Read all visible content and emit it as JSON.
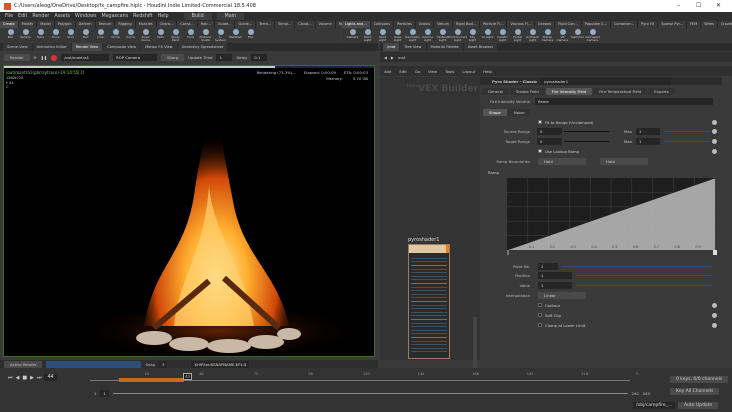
{
  "window": {
    "title": "C:/Users/aleog/OneDrive/Desktop/fx_campfire.hiplc - Houdini Indie Limited-Commercial 18.5.408",
    "min": "–",
    "max": "☐",
    "close": "✕"
  },
  "menu": {
    "items": [
      "File",
      "Edit",
      "Render",
      "Assets",
      "Windows",
      "Megascans",
      "Redshift",
      "Help"
    ],
    "desktop": "Build",
    "desktop2": "Main"
  },
  "shelf_tabs_left": [
    "Create",
    "Modify",
    "Model",
    "Polygon",
    "Deform",
    "Texture",
    "Rigging",
    "Muscles",
    "Chara...",
    "Const...",
    "Hair...",
    "Guide...",
    "Guide...",
    "Terra...",
    "Simpl...",
    "Cloud...",
    "Volume",
    "Redshift"
  ],
  "shelf_tabs_right": [
    "Lights and...",
    "Collisions",
    "Particles",
    "Grains",
    "Vellum",
    "Rigid Bod...",
    "Particle Fl...",
    "Viscous Fl...",
    "Oceans",
    "Fluid Con...",
    "Populate C...",
    "Container...",
    "Pyro FX",
    "Sparse Pyr...",
    "FEM",
    "Wires",
    "Crowds",
    "Drive Sim..."
  ],
  "tools_left": [
    "Box",
    "Sphere",
    "Tube",
    "Torus",
    "Grid",
    "Null",
    "Line",
    "Circle",
    "Curve",
    "Draw Curve",
    "Path",
    "Spray Paint",
    "Font",
    "Platonic Solids",
    "L-System",
    "Metaball",
    "File"
  ],
  "tools_right": [
    "Camera",
    "Point Light",
    "Spot Light",
    "Area Light",
    "Geometry Light",
    "Volume Light",
    "Distant Light",
    "Environment Light",
    "Sky Light",
    "GI Light",
    "Caustic Light",
    "Portal Light",
    "Ambient Light",
    "Stereo Camera",
    "VR Camera",
    "Switcher",
    "Gamepad Camera"
  ],
  "left_panes": [
    "Scene View",
    "Animation Editor",
    "Render View",
    "Composite View",
    "Motion FX View",
    "Geometry Spreadsheet"
  ],
  "render_toolbar": {
    "render": "Render",
    "rop": "/out/mantra1",
    "camera": "ROP Camera",
    "snap": "Sharp",
    "update_label": "Update Time",
    "update": "1",
    "delay_label": "Delay",
    "delay": "0.1"
  },
  "viewport": {
    "path": "/out/mantra1(pbrraytrace)-19:14:55[1]",
    "res": "1280x720",
    "frame": "f: 44",
    "c": "C",
    "status": "Rendering (73.3%)...",
    "elapsed": "Elapsed: 0:00:09",
    "eta": "ETA: 0:00:03",
    "memory_label": "Memory:",
    "memory": "5.70 GB",
    "progress": 0.733
  },
  "render_bottom": {
    "active": "Active Render",
    "snap": "Snap",
    "snap_val": "3",
    "output": "$HIP/ipr/$SNAPNAME.$F4.$"
  },
  "right_panes": [
    "/mat",
    "Tree View",
    "Material Palette",
    "Asset Browser"
  ],
  "net": {
    "path": "mat",
    "menu": [
      "Add",
      "Edit",
      "Go",
      "View",
      "Tools",
      "Layout",
      "Help"
    ],
    "watermark_small": "Indie",
    "watermark": "VEX Builder",
    "node": "pyroshader1"
  },
  "params": {
    "type": "Pyro Shader - Classic",
    "name": "pyroshader1",
    "tabs": [
      "General",
      "Smoke Field",
      "Fire Intensity Field",
      "Fire Temperature Field",
      "Exports"
    ],
    "fire_vol_label": "Fire Intensity Volume",
    "fire_vol": "flame",
    "subtabs": [
      "Shape",
      "Noise"
    ],
    "fit": "Fit to Range (Unclamped)",
    "source_label": "Source Range",
    "source_min": "0",
    "source_max": "1",
    "target_label": "Target Range",
    "target_min": "0",
    "target_max": "1",
    "max_label": "Max",
    "use_ramp": "Use Lookup Ramp",
    "bound_label": "Ramp Boundaries",
    "bound1": "Hold",
    "bound2": "Hold",
    "ramp_label": "Ramp",
    "ramp_ticks": [
      "0.1",
      "0.2",
      "0.3",
      "0.4",
      "0.5",
      "0.6",
      "0.7",
      "0.8",
      "0.9"
    ],
    "point_label": "Point No.",
    "point": "2",
    "pos_label": "Position",
    "pos": "1",
    "val_label": "Value",
    "val": "1",
    "interp_label": "Interpolation",
    "interp": "Linear",
    "contour": "Contour",
    "softclip": "Soft Clip",
    "clamp": "Clamp at Lower Limit"
  },
  "timeline": {
    "frame": "44",
    "ticks": [
      "24",
      "48",
      "72",
      "96",
      "120",
      "144",
      "168",
      "192",
      "216",
      "2"
    ],
    "start": "1",
    "start2": "1",
    "end": "240",
    "end2": "240",
    "keys": "0 keys, 0/0 channels",
    "key_all": "Key All Channels",
    "status_path": "/obj/campfire_...",
    "auto": "Auto Update"
  }
}
